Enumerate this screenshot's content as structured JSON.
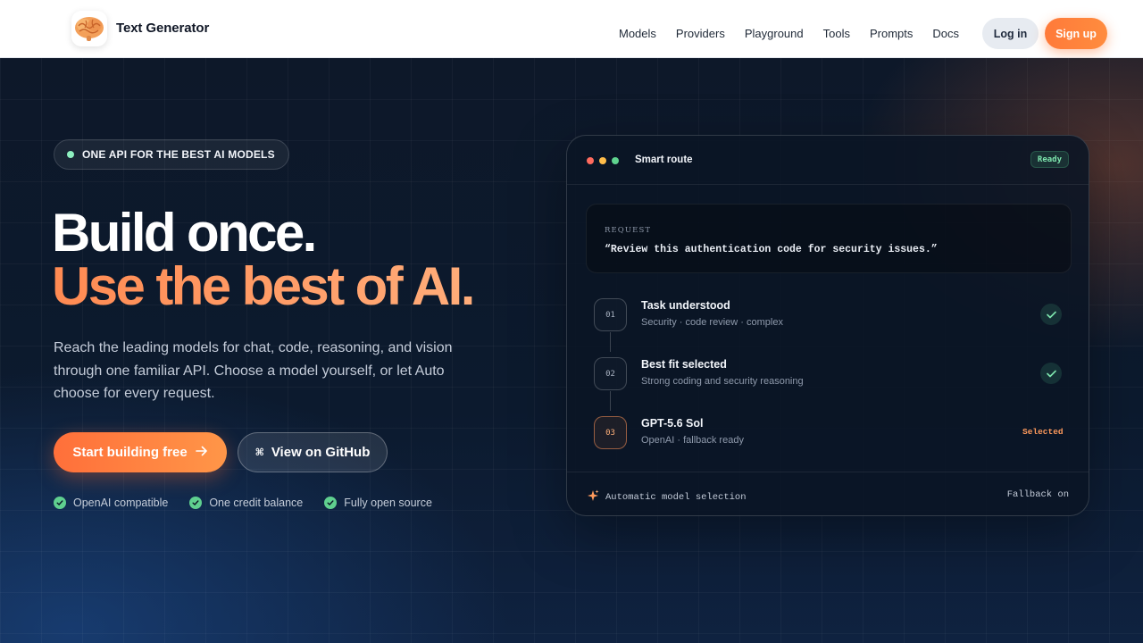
{
  "header": {
    "brand_name": "Text Generator",
    "logo_icon": "brain-icon",
    "nav": [
      "Models",
      "Providers",
      "Playground",
      "Tools",
      "Prompts",
      "Docs"
    ],
    "login_label": "Log in",
    "signup_label": "Sign up"
  },
  "hero": {
    "badge": "ONE API FOR THE BEST AI MODELS",
    "headline_line1": "Build once.",
    "headline_line2": "Use the best of AI.",
    "lede": "Reach the leading models for chat, code, reasoning, and vision through one familiar API. Choose a model yourself, or let Auto choose for every request.",
    "primary_cta": "Start building free",
    "secondary_cta": "View on GitHub",
    "secondary_cta_icon": "⌘",
    "perks": [
      "OpenAI compatible",
      "One credit balance",
      "Fully open source"
    ]
  },
  "card": {
    "title": "Smart route",
    "status": "Ready",
    "request_label": "REQUEST",
    "request_text": "“Review this authentication code for security issues.”",
    "steps": [
      {
        "num": "01",
        "title": "Task understood",
        "sub": "Security · code review · complex",
        "state": "done"
      },
      {
        "num": "02",
        "title": "Best fit selected",
        "sub": "Strong coding and security reasoning",
        "state": "done"
      },
      {
        "num": "03",
        "title": "GPT-5.6 Sol",
        "sub": "OpenAI · fallback ready",
        "state": "Selected"
      }
    ],
    "footer_left": "Automatic model selection",
    "footer_right": "Fallback on"
  },
  "colors": {
    "accent": "#ff8a4c",
    "background": "#0b1526",
    "success": "#5fcf8f"
  }
}
